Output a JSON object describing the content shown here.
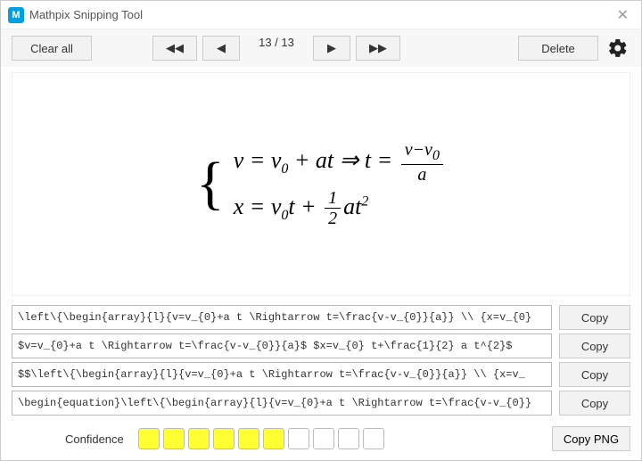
{
  "window": {
    "title": "Mathpix Snipping Tool"
  },
  "toolbar": {
    "clear_all": "Clear all",
    "page_counter": "13 / 13",
    "delete": "Delete"
  },
  "equations": {
    "line1_html": "v = v<span class='sub'>0</span> + at ⇒ t = <span class='frac'><span class='num'>v−v<span class='sub'>0</span></span><span class='den'>a</span></span>",
    "line2_html": "x = v<span class='sub'>0</span>t + <span class='frac'><span class='num'>1</span><span class='den'>2</span></span>at<span class='sup'>2</span>"
  },
  "results": [
    {
      "value": "\\left\\{\\begin{array}{l}{v=v_{0}+a t \\Rightarrow t=\\frac{v-v_{0}}{a}} \\\\ {x=v_{0}"
    },
    {
      "value": "$v=v_{0}+a t \\Rightarrow t=\\frac{v-v_{0}}{a}$ $x=v_{0} t+\\frac{1}{2} a t^{2}$"
    },
    {
      "value": "$$\\left\\{\\begin{array}{l}{v=v_{0}+a t \\Rightarrow t=\\frac{v-v_{0}}{a}} \\\\ {x=v_"
    },
    {
      "value": "\\begin{equation}\\left\\{\\begin{array}{l}{v=v_{0}+a t \\Rightarrow t=\\frac{v-v_{0}}"
    }
  ],
  "copy_label": "Copy",
  "footer": {
    "confidence_label": "Confidence",
    "confidence_boxes": [
      true,
      true,
      true,
      true,
      true,
      true,
      false,
      false,
      false,
      false
    ],
    "copy_png": "Copy PNG"
  }
}
